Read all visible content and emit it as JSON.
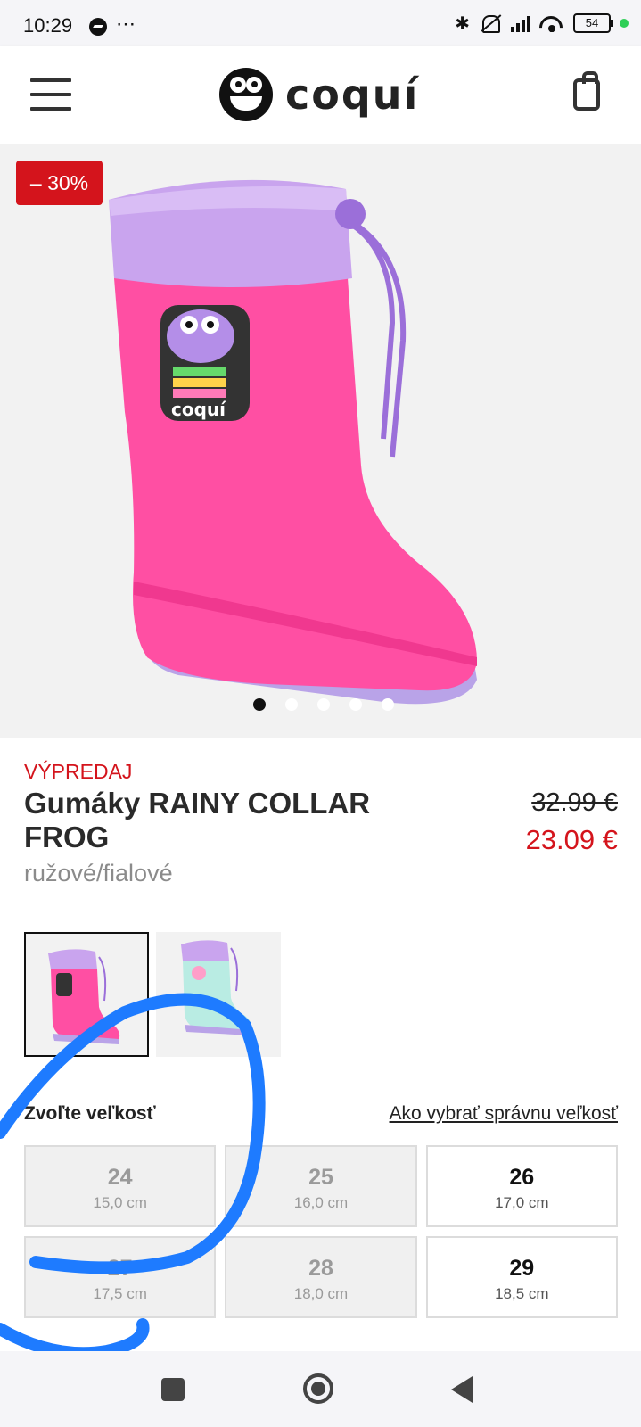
{
  "status_bar": {
    "time": "10:29",
    "dots": "⋯",
    "battery": "54"
  },
  "header": {
    "logo_text": "coquí"
  },
  "product": {
    "badge": "– 30%",
    "category": "VÝPREDAJ",
    "title": "Gumáky RAINY COLLAR FROG",
    "color": "ružové/fialové",
    "old_price": "32.99 €",
    "new_price": "23.09 €",
    "carousel_active_index": 0,
    "carousel_count": 5
  },
  "sizes": {
    "label": "Zvoľte veľkosť",
    "guide_link": "Ako vybrať správnu veľkosť",
    "items": [
      {
        "num": "24",
        "cm": "15,0 cm",
        "available": false
      },
      {
        "num": "25",
        "cm": "16,0 cm",
        "available": false
      },
      {
        "num": "26",
        "cm": "17,0 cm",
        "available": true
      },
      {
        "num": "27",
        "cm": "17,5 cm",
        "available": false
      },
      {
        "num": "28",
        "cm": "18,0 cm",
        "available": false
      },
      {
        "num": "29",
        "cm": "18,5 cm",
        "available": true
      }
    ]
  },
  "colors": {
    "sale_red": "#d4141c",
    "boot_pink": "#ff4fa3",
    "collar_lilac": "#c9a4ee",
    "annotation_blue": "#1e7bff"
  }
}
